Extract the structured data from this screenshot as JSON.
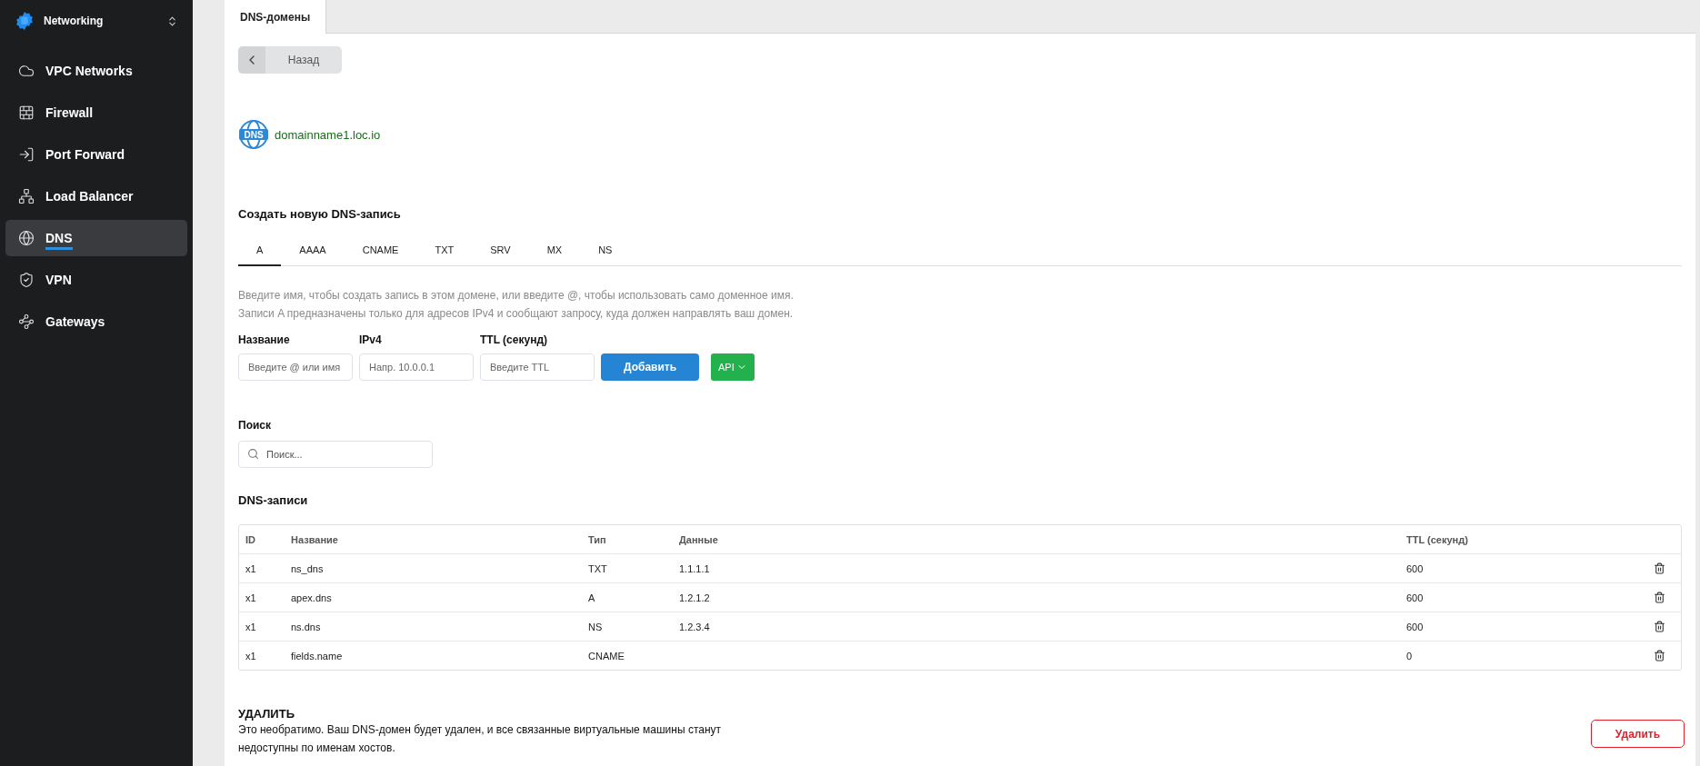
{
  "sidebar": {
    "product": "Networking",
    "items": [
      {
        "label": "VPC Networks",
        "selected": false
      },
      {
        "label": "Firewall",
        "selected": false
      },
      {
        "label": "Port Forward",
        "selected": false
      },
      {
        "label": "Load Balancer",
        "selected": false
      },
      {
        "label": "DNS",
        "selected": true
      },
      {
        "label": "VPN",
        "selected": false
      },
      {
        "label": "Gateways",
        "selected": false
      }
    ]
  },
  "page_tabs": [
    {
      "label": "DNS-домены",
      "selected": true
    }
  ],
  "back_button": "Назад",
  "domain_badge": "DNS",
  "domain": "domainname1.loc.io",
  "create": {
    "title": "Создать новую DNS-запись",
    "record_tabs": [
      {
        "label": "A",
        "selected": true
      },
      {
        "label": "AAAA",
        "selected": false
      },
      {
        "label": "CNAME",
        "selected": false
      },
      {
        "label": "TXT",
        "selected": false
      },
      {
        "label": "SRV",
        "selected": false
      },
      {
        "label": "MX",
        "selected": false
      },
      {
        "label": "NS",
        "selected": false
      }
    ],
    "hint_lines": [
      "Введите имя, чтобы создать запись в этом домене, или введите @, чтобы использовать само доменное имя.",
      "Записи A предназначены только для адресов IPv4 и сообщают запросу, куда должен направлять ваш домен."
    ],
    "fields": [
      {
        "label": "Название",
        "placeholder": "Введите @ или имя"
      },
      {
        "label": "IPv4",
        "placeholder": "Напр. 10.0.0.1"
      },
      {
        "label": "TTL (секунд)",
        "placeholder": "Введите TTL"
      }
    ],
    "add_button": "Добавить",
    "api_button": "API"
  },
  "search": {
    "label": "Поиск",
    "placeholder": "Поиск..."
  },
  "records": {
    "title": "DNS-записи",
    "columns": [
      "ID",
      "Название",
      "Тип",
      "Данные",
      "TTL (секунд)"
    ],
    "rows": [
      [
        "x1",
        "ns_dns",
        "TXT",
        "1.1.1.1",
        "600"
      ],
      [
        "x1",
        "apex.dns",
        "A",
        "1.2.1.2",
        "600"
      ],
      [
        "x1",
        "ns.dns",
        "NS",
        "1.2.3.4",
        "600"
      ],
      [
        "x1",
        "fields.name",
        "CNAME",
        "",
        "0"
      ]
    ]
  },
  "danger": {
    "title": "УДАЛИТЬ",
    "text_lines": [
      "Это необратимо. Ваш DNS-домен будет удален, и все связанные виртуальные машины станут",
      "недоступны по именам хостов."
    ],
    "button": "Удалить"
  }
}
